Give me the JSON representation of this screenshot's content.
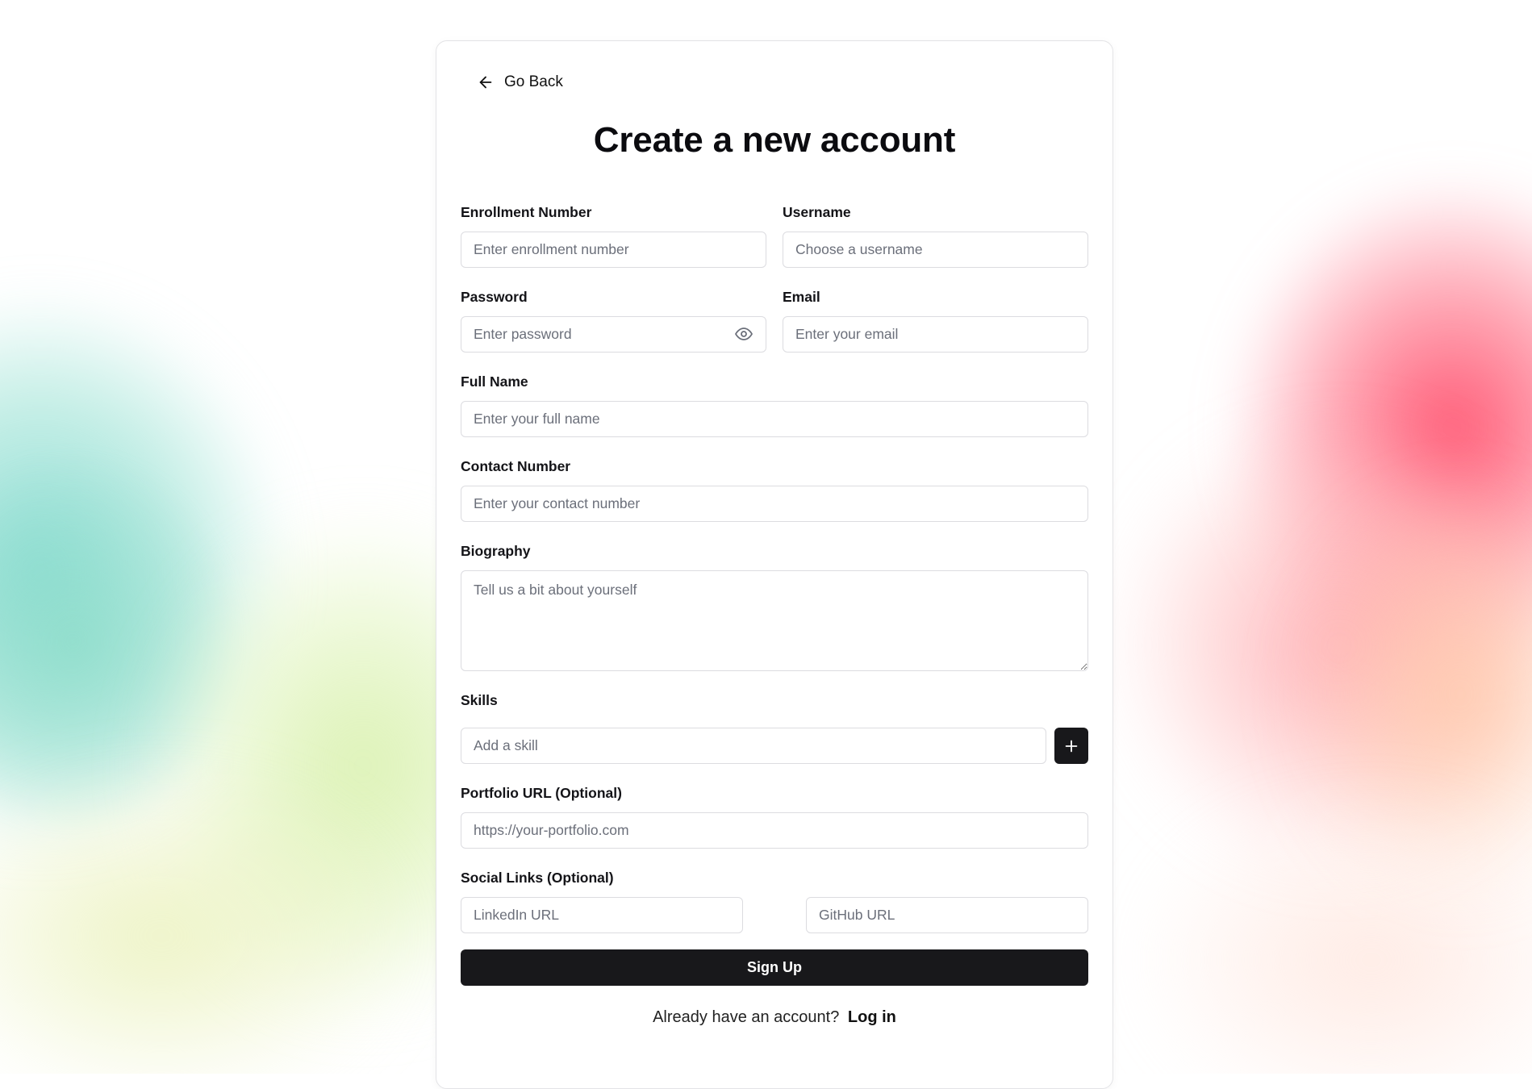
{
  "header": {
    "back_label": "Go Back",
    "title": "Create a new account"
  },
  "form": {
    "enrollment": {
      "label": "Enrollment Number",
      "placeholder": "Enter enrollment number",
      "value": ""
    },
    "username": {
      "label": "Username",
      "placeholder": "Choose a username",
      "value": ""
    },
    "password": {
      "label": "Password",
      "placeholder": "Enter password",
      "value": ""
    },
    "email": {
      "label": "Email",
      "placeholder": "Enter your email",
      "value": ""
    },
    "full_name": {
      "label": "Full Name",
      "placeholder": "Enter your full name",
      "value": ""
    },
    "contact": {
      "label": "Contact Number",
      "placeholder": "Enter your contact number",
      "value": ""
    },
    "biography": {
      "label": "Biography",
      "placeholder": "Tell us a bit about yourself",
      "value": ""
    },
    "skills": {
      "label": "Skills",
      "placeholder": "Add a skill",
      "value": ""
    },
    "portfolio": {
      "label": "Portfolio URL (Optional)",
      "placeholder": "https://your-portfolio.com",
      "value": ""
    },
    "social": {
      "label": "Social Links (Optional)",
      "linkedin_placeholder": "LinkedIn URL",
      "github_placeholder": "GitHub URL"
    },
    "submit_label": "Sign Up"
  },
  "footer": {
    "prompt": "Already have an account?",
    "login_label": "Log in"
  },
  "icons": {
    "back": "arrow-left-icon",
    "password_toggle": "eye-icon",
    "add_skill": "plus-icon"
  },
  "colors": {
    "primary_button": "#18181b",
    "input_border": "#dcdce0",
    "placeholder": "#6b6f7a"
  }
}
